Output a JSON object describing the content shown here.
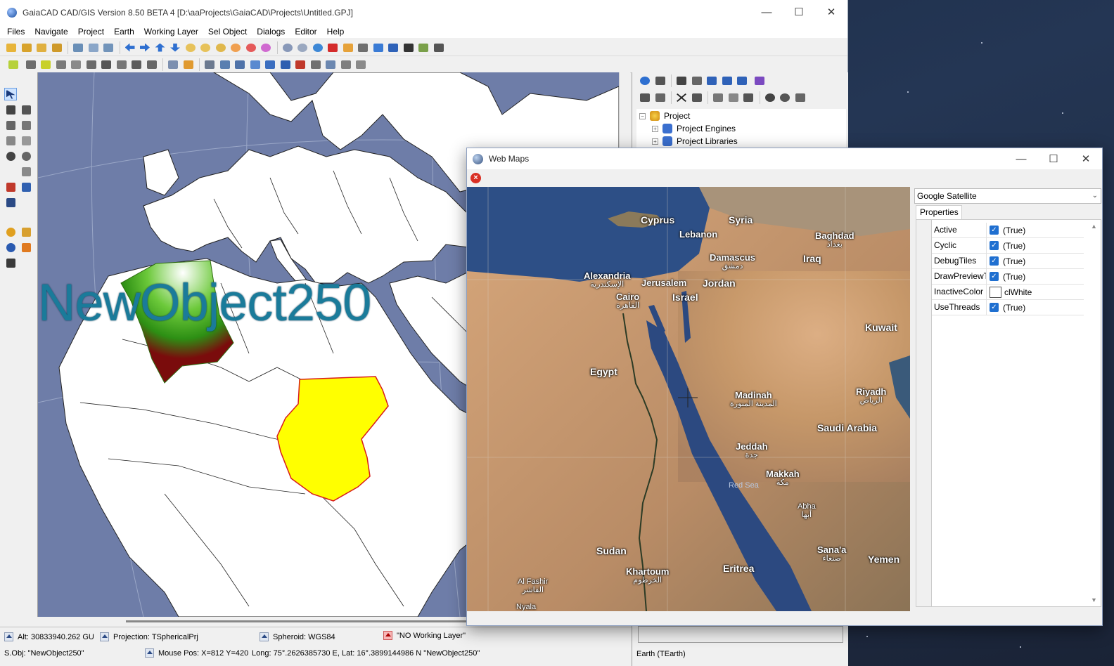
{
  "main_window": {
    "title": "GaiaCAD CAD/GIS Version 8.50 BETA 4  [D:\\aaProjects\\GaiaCAD\\Projects\\Untitled.GPJ]",
    "controls": {
      "minimize": "—",
      "maximize": "☐",
      "close": "✕"
    }
  },
  "menu": [
    "Files",
    "Navigate",
    "Project",
    "Earth",
    "Working Layer",
    "Sel Object",
    "Dialogs",
    "Editor",
    "Help"
  ],
  "map": {
    "object_label": "NewObject250",
    "colors": {
      "ocean": "#6e7da8",
      "land": "#ffffff",
      "highlight": "#ffff00",
      "selected": "#7a0c0c",
      "gradient": "#3aa01a"
    }
  },
  "tree": {
    "root": "Project",
    "children": [
      "Project Engines",
      "Project Libraries"
    ]
  },
  "status": {
    "alt": "Alt: 30833940.262 GU",
    "projection": "Projection: TSphericalPrj",
    "spheroid": "Spheroid: WGS84",
    "working_layer": "\"NO Working Layer\"",
    "sel_obj": "S.Obj: \"NewObject250\"",
    "mouse_pos": "Mouse Pos: X=812 Y=420",
    "long_lat": "Long: 75°.2626385730 E, Lat: 16°.3899144986 N  \"NewObject250\""
  },
  "right_panel_status": "Earth (TEarth)",
  "web_maps": {
    "title": "Web Maps",
    "provider": "Google Satellite",
    "properties_tab": "Properties",
    "properties": [
      {
        "name": "Active",
        "value": "(True)",
        "type": "bool"
      },
      {
        "name": "Cyclic",
        "value": "(True)",
        "type": "bool"
      },
      {
        "name": "DebugTiles",
        "value": "(True)",
        "type": "bool"
      },
      {
        "name": "DrawPreviewT",
        "value": "(True)",
        "type": "bool"
      },
      {
        "name": "InactiveColor",
        "value": "clWhite",
        "type": "color"
      },
      {
        "name": "UseThreads",
        "value": "(True)",
        "type": "bool"
      }
    ],
    "map_labels": {
      "cyprus": "Cyprus",
      "syria": "Syria",
      "lebanon": "Lebanon",
      "baghdad": "Baghdad",
      "baghdad_ar": "بغداد",
      "damascus": "Damascus",
      "damascus_ar": "دمشق",
      "iraq": "Iraq",
      "alexandria": "Alexandria",
      "alexandria_ar": "الإسكندرية",
      "jerusalem": "Jerusalem",
      "jordan": "Jordan",
      "cairo": "Cairo",
      "cairo_ar": "القاهرة",
      "israel": "Israel",
      "kuwait": "Kuwait",
      "egypt": "Egypt",
      "madinah": "Madinah",
      "madinah_ar": "المدينة المنورة",
      "riyadh": "Riyadh",
      "riyadh_ar": "الرياض",
      "saudi_arabia": "Saudi Arabia",
      "jeddah": "Jeddah",
      "jeddah_ar": "جدة",
      "makkah": "Makkah",
      "makkah_ar": "مكة",
      "red_sea": "Red Sea",
      "abha": "Abha",
      "abha_ar": "أبها",
      "sudan": "Sudan",
      "sanaa": "Sana'a",
      "sanaa_ar": "صنعاء",
      "yemen": "Yemen",
      "eritrea": "Eritrea",
      "khartoum": "Khartoum",
      "khartoum_ar": "الخرطوم",
      "al_fashir": "Al Fashir",
      "al_fashir_ar": "الفاشر",
      "nyala": "Nyala"
    }
  }
}
